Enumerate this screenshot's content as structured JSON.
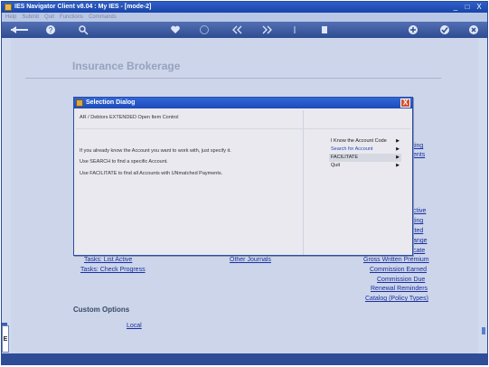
{
  "window": {
    "title": "IES Navigator Client v8.04 : My IES -        [mode-2]",
    "controls": [
      "_",
      "□",
      "X"
    ]
  },
  "menubar": [
    "Help",
    "Submit",
    "Quit",
    "Functions",
    "Commands"
  ],
  "toolbar": {
    "icons": [
      "back-arrow-icon",
      "help-icon",
      "search-icon",
      "heart-icon",
      "clock-icon",
      "rewind-icon",
      "forward-icon",
      "bar-icon",
      "stop-icon",
      "add-icon",
      "check-icon",
      "close-icon"
    ]
  },
  "page": {
    "heading": "Insurance Brokerage",
    "left_links": [
      "Tasks: List Active",
      "Tasks: Check Progress"
    ],
    "center_links": [
      "Other Journals"
    ],
    "right_links_partial": [
      "ting",
      "ents",
      "ctive",
      "ting",
      "ited",
      "ange",
      "cate"
    ],
    "right_links": [
      "Gross Written Premium",
      "Commission Earned",
      "Commission Due",
      "Renewal Reminders",
      "Catalog (Policy Types)"
    ],
    "custom_options_title": "Custom Options",
    "custom_options_link": "Local"
  },
  "sidetab": {
    "label": "E"
  },
  "dialog": {
    "title": "Selection Dialog",
    "close": "X",
    "subtitle": "AR / Debtors EXTENDED Open Item Control",
    "lines": [
      "If you already know the Account you want to work with, just specify it.",
      "Use SEARCH to find a specific Account.",
      "Use FACILITATE to find all Accounts with UNmatched Payments."
    ],
    "menu": [
      {
        "label": "I Know the Account Code",
        "arrow": "▶"
      },
      {
        "label": "Search for Account",
        "arrow": "▶"
      },
      {
        "label": "FACILITATE",
        "arrow": "▶"
      },
      {
        "label": "Quit",
        "arrow": "▶"
      }
    ]
  }
}
